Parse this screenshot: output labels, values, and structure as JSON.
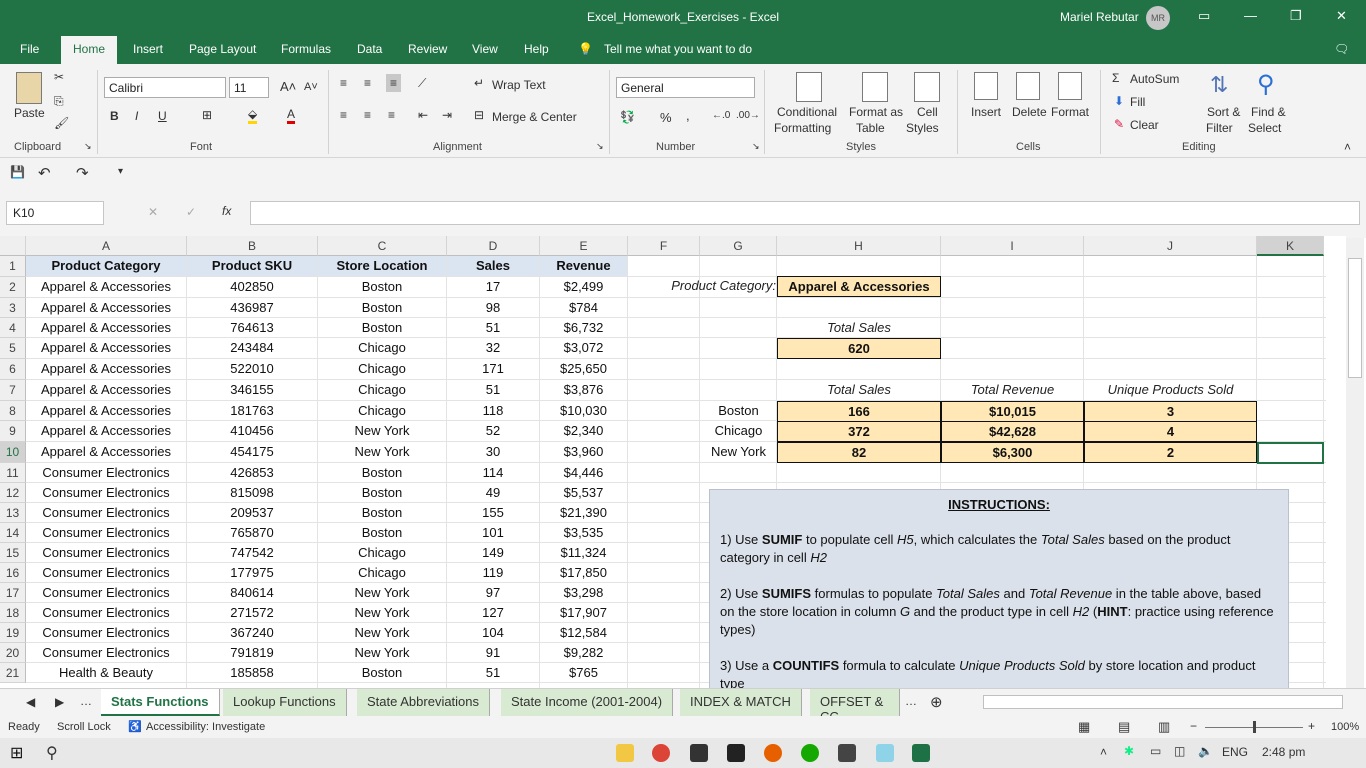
{
  "window": {
    "title": "Excel_Homework_Exercises  -  Excel",
    "user": "Mariel Rebutar",
    "initials": "MR"
  },
  "menu": [
    "File",
    "Home",
    "Insert",
    "Page Layout",
    "Formulas",
    "Data",
    "Review",
    "View",
    "Help"
  ],
  "tellme": "Tell me what you want to do",
  "ribbon": {
    "paste": "Paste",
    "font_name": "Calibri",
    "font_size": "11",
    "wrap_text": "Wrap Text",
    "merge_center": "Merge & Center",
    "number_format": "General",
    "conditional": "Conditional",
    "formatting": "Formatting",
    "format_as": "Format as",
    "table": "Table",
    "cell": "Cell",
    "styles_lbl": "Styles",
    "insert": "Insert",
    "delete": "Delete",
    "format": "Format",
    "autosum": "AutoSum",
    "fill": "Fill",
    "clear": "Clear",
    "sort_filter_1": "Sort &",
    "sort_filter_2": "Filter",
    "find_select_1": "Find &",
    "find_select_2": "Select",
    "groups": {
      "clipboard": "Clipboard",
      "font": "Font",
      "alignment": "Alignment",
      "number": "Number",
      "styles": "Styles",
      "cells": "Cells",
      "editing": "Editing"
    }
  },
  "formula_bar": {
    "name_box": "K10",
    "formula": ""
  },
  "columns": [
    "A",
    "B",
    "C",
    "D",
    "E",
    "F",
    "G",
    "H",
    "I",
    "J",
    "K"
  ],
  "table_headers": [
    "Product Category",
    "Product SKU",
    "Store Location",
    "Sales",
    "Revenue"
  ],
  "rows": [
    [
      "Apparel & Accessories",
      "402850",
      "Boston",
      "17",
      "$2,499"
    ],
    [
      "Apparel & Accessories",
      "436987",
      "Boston",
      "98",
      "$784"
    ],
    [
      "Apparel & Accessories",
      "764613",
      "Boston",
      "51",
      "$6,732"
    ],
    [
      "Apparel & Accessories",
      "243484",
      "Chicago",
      "32",
      "$3,072"
    ],
    [
      "Apparel & Accessories",
      "522010",
      "Chicago",
      "171",
      "$25,650"
    ],
    [
      "Apparel & Accessories",
      "346155",
      "Chicago",
      "51",
      "$3,876"
    ],
    [
      "Apparel & Accessories",
      "181763",
      "Chicago",
      "118",
      "$10,030"
    ],
    [
      "Apparel & Accessories",
      "410456",
      "New York",
      "52",
      "$2,340"
    ],
    [
      "Apparel & Accessories",
      "454175",
      "New York",
      "30",
      "$3,960"
    ],
    [
      "Consumer Electronics",
      "426853",
      "Boston",
      "114",
      "$4,446"
    ],
    [
      "Consumer Electronics",
      "815098",
      "Boston",
      "49",
      "$5,537"
    ],
    [
      "Consumer Electronics",
      "209537",
      "Boston",
      "155",
      "$21,390"
    ],
    [
      "Consumer Electronics",
      "765870",
      "Boston",
      "101",
      "$3,535"
    ],
    [
      "Consumer Electronics",
      "747542",
      "Chicago",
      "149",
      "$11,324"
    ],
    [
      "Consumer Electronics",
      "177975",
      "Chicago",
      "119",
      "$17,850"
    ],
    [
      "Consumer Electronics",
      "840614",
      "New York",
      "97",
      "$3,298"
    ],
    [
      "Consumer Electronics",
      "271572",
      "New York",
      "127",
      "$17,907"
    ],
    [
      "Consumer Electronics",
      "367240",
      "New York",
      "104",
      "$12,584"
    ],
    [
      "Consumer Electronics",
      "791819",
      "New York",
      "91",
      "$9,282"
    ],
    [
      "Health & Beauty",
      "185858",
      "Boston",
      "51",
      "$765"
    ]
  ],
  "summary": {
    "category_label": "Product Category:",
    "category_value": "Apparel & Accessories",
    "total_sales_label": "Total Sales",
    "total_sales_value": "620",
    "col_total_sales": "Total Sales",
    "col_total_revenue": "Total Revenue",
    "col_unique": "Unique Products Sold",
    "stores": [
      {
        "name": "Boston",
        "sales": "166",
        "revenue": "$10,015",
        "unique": "3"
      },
      {
        "name": "Chicago",
        "sales": "372",
        "revenue": "$42,628",
        "unique": "4"
      },
      {
        "name": "New York",
        "sales": "82",
        "revenue": "$6,300",
        "unique": "2"
      }
    ]
  },
  "instructions": {
    "title": "INSTRUCTIONS:",
    "s1a": "1) Use ",
    "s1b": "SUMIF",
    "s1c": " to populate cell ",
    "s1d": "H5",
    "s1e": ", which calculates the ",
    "s1f": "Total Sales",
    "s1g": " based on the product category in cell ",
    "s1h": "H2",
    "s2a": "2) Use ",
    "s2b": "SUMIFS",
    "s2c": " formulas to populate ",
    "s2d": "Total Sales",
    "s2e": " and ",
    "s2f": "Total Revenue",
    "s2g": " in the table above, based on the store location in column ",
    "s2h": "G",
    "s2i": " and the product type in cell ",
    "s2j": "H2",
    "s2k": " (",
    "s2l": "HINT",
    "s2m": ": practice using reference types)",
    "s3a": "3) Use a ",
    "s3b": "COUNTIFS",
    "s3c": " formula to calculate ",
    "s3d": "Unique Products Sold",
    "s3e": " by store location and product type"
  },
  "sheet_tabs": [
    "Stats Functions",
    "Lookup Functions",
    "State Abbreviations",
    "State Income (2001-2004)",
    "INDEX & MATCH",
    "OFFSET & CC"
  ],
  "status": {
    "ready": "Ready",
    "scroll_lock": "Scroll Lock",
    "accessibility": "Accessibility: Investigate",
    "zoom": "100%"
  },
  "taskbar": {
    "lang": "ENG",
    "time": "2:48 pm"
  }
}
